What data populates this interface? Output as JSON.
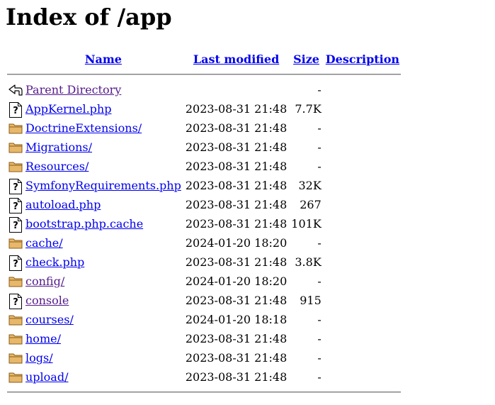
{
  "page": {
    "title": "Index of /app"
  },
  "columns": {
    "name": "Name",
    "last_modified": "Last modified",
    "size": "Size",
    "description": "Description"
  },
  "rows": [
    {
      "type": "back",
      "name": "Parent Directory",
      "date": "",
      "size": "-",
      "visited": true
    },
    {
      "type": "unknown",
      "name": "AppKernel.php",
      "date": "2023-08-31 21:48",
      "size": "7.7K",
      "visited": false
    },
    {
      "type": "folder",
      "name": "DoctrineExtensions/",
      "date": "2023-08-31 21:48",
      "size": "-",
      "visited": false
    },
    {
      "type": "folder",
      "name": "Migrations/",
      "date": "2023-08-31 21:48",
      "size": "-",
      "visited": false
    },
    {
      "type": "folder",
      "name": "Resources/",
      "date": "2023-08-31 21:48",
      "size": "-",
      "visited": false
    },
    {
      "type": "unknown",
      "name": "SymfonyRequirements.php",
      "date": "2023-08-31 21:48",
      "size": "32K",
      "visited": false
    },
    {
      "type": "unknown",
      "name": "autoload.php",
      "date": "2023-08-31 21:48",
      "size": "267",
      "visited": false
    },
    {
      "type": "unknown",
      "name": "bootstrap.php.cache",
      "date": "2023-08-31 21:48",
      "size": "101K",
      "visited": false
    },
    {
      "type": "folder",
      "name": "cache/",
      "date": "2024-01-20 18:20",
      "size": "-",
      "visited": false
    },
    {
      "type": "unknown",
      "name": "check.php",
      "date": "2023-08-31 21:48",
      "size": "3.8K",
      "visited": false
    },
    {
      "type": "folder",
      "name": "config/",
      "date": "2024-01-20 18:20",
      "size": "-",
      "visited": true
    },
    {
      "type": "unknown",
      "name": "console",
      "date": "2023-08-31 21:48",
      "size": "915",
      "visited": true
    },
    {
      "type": "folder",
      "name": "courses/",
      "date": "2024-01-20 18:18",
      "size": "-",
      "visited": false
    },
    {
      "type": "folder",
      "name": "home/",
      "date": "2023-08-31 21:48",
      "size": "-",
      "visited": false
    },
    {
      "type": "folder",
      "name": "logs/",
      "date": "2023-08-31 21:48",
      "size": "-",
      "visited": false
    },
    {
      "type": "folder",
      "name": "upload/",
      "date": "2023-08-31 21:48",
      "size": "-",
      "visited": false
    }
  ],
  "icons": {
    "back": "back-arrow-icon",
    "unknown": "unknown-file-icon",
    "folder": "folder-icon"
  },
  "colors": {
    "link": "#0000ee",
    "visited_link": "#551a8b",
    "folder_fill": "#e8b86a",
    "folder_stroke": "#8a5a14"
  }
}
